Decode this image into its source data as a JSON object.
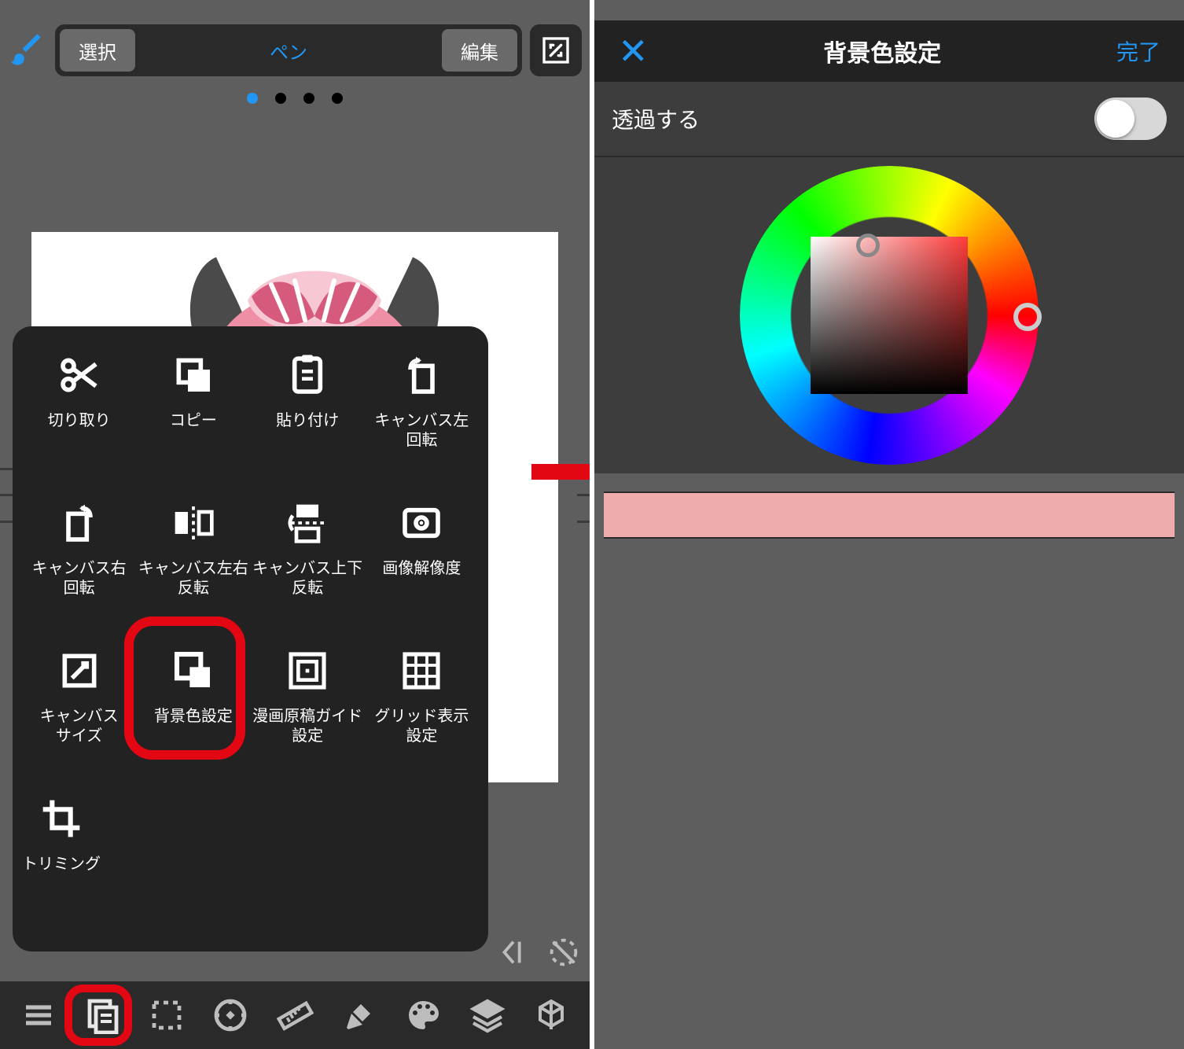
{
  "left": {
    "toolbar": {
      "select": "選択",
      "pen": "ペン",
      "edit": "編集"
    },
    "popup": [
      {
        "name": "cut",
        "label": "切り取り"
      },
      {
        "name": "copy",
        "label": "コピー"
      },
      {
        "name": "paste",
        "label": "貼り付け"
      },
      {
        "name": "canvas-rot-l",
        "label": "キャンバス左\n回転"
      },
      {
        "name": "canvas-rot-r",
        "label": "キャンバス右\n回転"
      },
      {
        "name": "canvas-flip-h",
        "label": "キャンバス左右\n反転"
      },
      {
        "name": "canvas-flip-v",
        "label": "キャンバス上下\n反転"
      },
      {
        "name": "resolution",
        "label": "画像解像度"
      },
      {
        "name": "canvas-size",
        "label": "キャンバス\nサイズ"
      },
      {
        "name": "bg-color",
        "label": "背景色設定"
      },
      {
        "name": "manga-guide",
        "label": "漫画原稿ガイド\n設定"
      },
      {
        "name": "grid",
        "label": "グリッド表示\n設定"
      },
      {
        "name": "trimming",
        "label": "トリミング"
      }
    ]
  },
  "right": {
    "title": "背景色設定",
    "done": "完了",
    "transparent_label": "透過する",
    "transparent_on": false,
    "swatch_color": "#efacac"
  }
}
